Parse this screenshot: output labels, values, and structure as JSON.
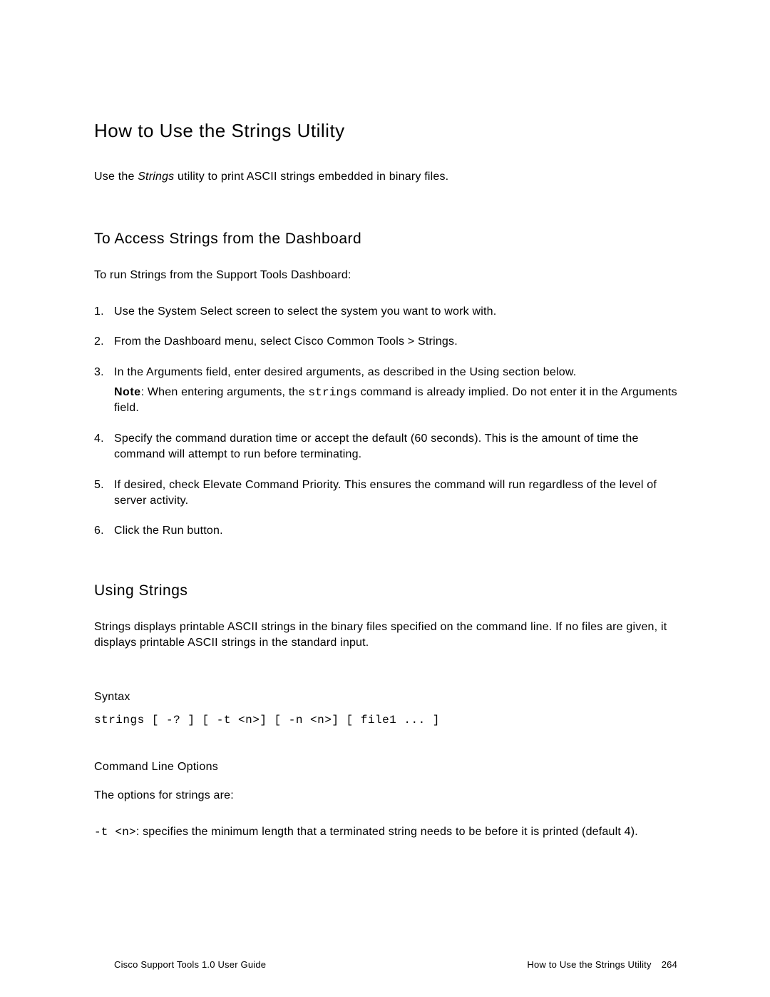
{
  "section": {
    "heading": "How to Use the Strings Utility",
    "intro_prefix": "Use the ",
    "intro_italic": "Strings",
    "intro_suffix": " utility to print ASCII strings embedded in binary files."
  },
  "access": {
    "heading": "To Access Strings from the Dashboard",
    "intro": "To run Strings from the Support Tools Dashboard:",
    "steps": [
      "Use the System Select screen to select the system you want to work with.",
      "From the Dashboard menu, select Cisco Common Tools > Strings.",
      "In the Arguments field, enter desired arguments, as described in the Using section below.",
      "Specify the command duration time or accept the default (60 seconds). This is the amount of time the command will attempt to run before terminating.",
      "If desired, check Elevate Command Priority. This ensures the command will run regardless of the level of server activity.",
      "Click the Run button."
    ],
    "step3_note_label": "Note",
    "step3_note_before": ": When entering arguments, the ",
    "step3_note_code": "strings",
    "step3_note_after": " command is already implied. Do not enter it in the Arguments field."
  },
  "using": {
    "heading": "Using Strings",
    "para": "Strings displays printable ASCII strings in the binary files specified on the command line. If no files are given, it displays printable ASCII strings in the standard input."
  },
  "syntax": {
    "heading": "Syntax",
    "code": "strings [ -? ] [ -t <n>] [ -n <n>] [ file1 ... ]"
  },
  "cli": {
    "heading": "Command Line Options",
    "intro": "The options for strings are:",
    "opt_t_code": "-t <n>",
    "opt_t_text": ": specifies the minimum length that a terminated string needs to be before it is printed (default 4)."
  },
  "footer": {
    "left": "Cisco Support Tools 1.0 User Guide",
    "right_title": "How to Use the Strings Utility",
    "page_number": "264"
  }
}
